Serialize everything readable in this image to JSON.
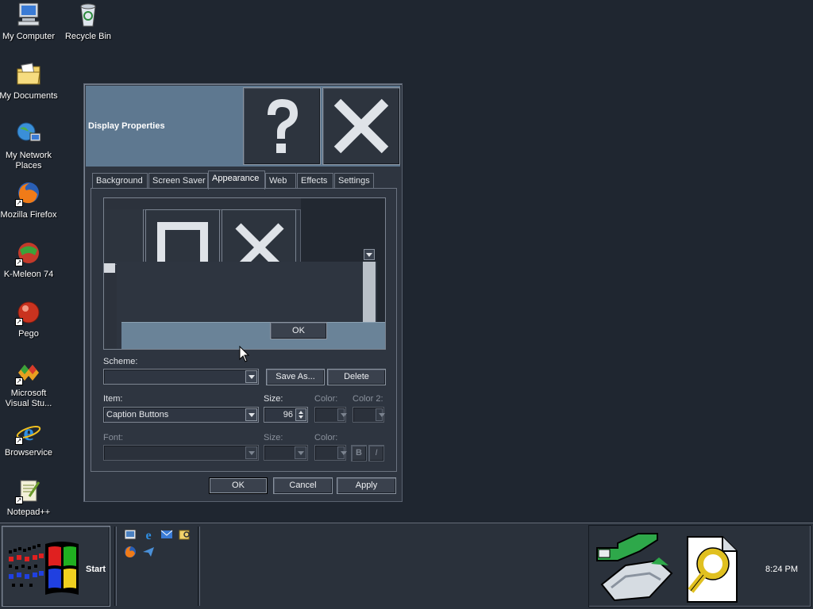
{
  "desktop": {
    "icons": [
      {
        "label": "My Computer",
        "icon": "computer-icon"
      },
      {
        "label": "Recycle Bin",
        "icon": "recycle-bin-icon"
      },
      {
        "label": "My Documents",
        "icon": "folder-documents-icon"
      },
      {
        "label": "My Network Places",
        "icon": "network-places-icon"
      },
      {
        "label": "Mozilla Firefox",
        "icon": "firefox-icon"
      },
      {
        "label": "K-Meleon 74",
        "icon": "kmeleon-icon"
      },
      {
        "label": "Pego",
        "icon": "pego-icon"
      },
      {
        "label": "Microsoft Visual Stu...",
        "icon": "visual-studio-icon"
      },
      {
        "label": "Browservice",
        "icon": "internet-explorer-icon"
      },
      {
        "label": "Notepad++",
        "icon": "notepad-plus-icon"
      }
    ]
  },
  "dialog": {
    "title": "Display Properties",
    "help_icon": "question-mark-icon",
    "close_icon": "close-x-icon",
    "tabs": [
      "Background",
      "Screen Saver",
      "Appearance",
      "Web",
      "Effects",
      "Settings"
    ],
    "active_tab": "Appearance",
    "preview": {
      "message_button": "OK"
    },
    "scheme": {
      "label": "Scheme:",
      "value": "",
      "save_as": "Save As...",
      "delete": "Delete"
    },
    "item": {
      "label": "Item:",
      "value": "Caption Buttons",
      "size_label": "Size:",
      "size_value": "96",
      "color_label": "Color:",
      "color2_label": "Color 2:"
    },
    "font": {
      "label": "Font:",
      "value": "",
      "size_label": "Size:",
      "color_label": "Color:",
      "bold": "B",
      "italic": "I"
    },
    "buttons": {
      "ok": "OK",
      "cancel": "Cancel",
      "apply": "Apply"
    }
  },
  "taskbar": {
    "start_label": "Start",
    "quick_launch": [
      "desktop-icon",
      "internet-explorer-icon",
      "outlook-express-icon",
      "explorer-search-icon",
      "firefox-icon",
      "send-icon"
    ],
    "tray_icons": [
      "network-connection-icon",
      "search-document-icon"
    ],
    "clock": "8:24 PM"
  },
  "colors": {
    "desktop": "#1f2630",
    "titlebar": "#5e7890",
    "dialog": "#2e3540"
  }
}
